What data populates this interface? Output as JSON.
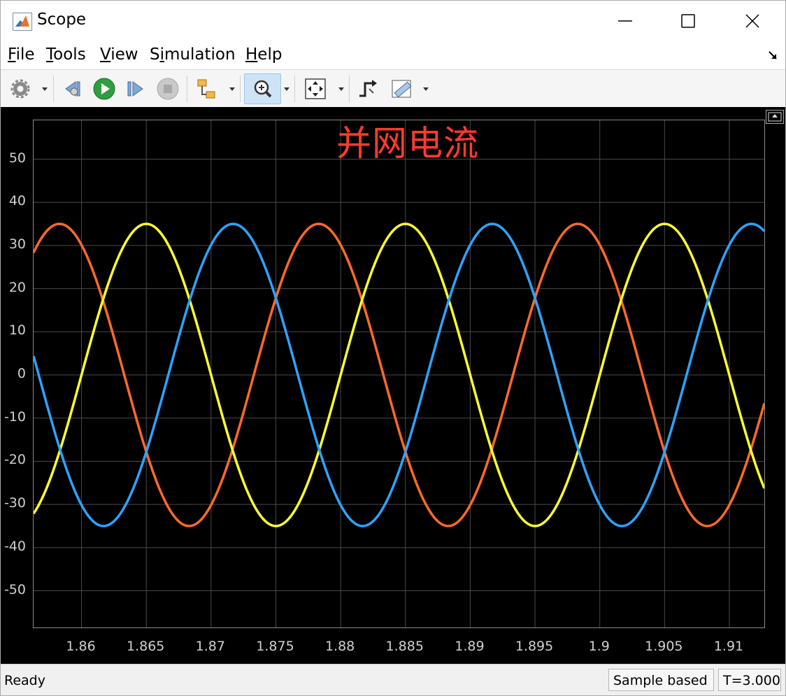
{
  "window": {
    "title": "Scope"
  },
  "menu": {
    "items": [
      {
        "label_acc": "F",
        "label_rest": "ile"
      },
      {
        "label_acc": "T",
        "label_rest": "ools"
      },
      {
        "label_acc": "V",
        "label_rest": "iew"
      },
      {
        "label_pre": "S",
        "label_acc": "i",
        "label_rest": "mulation"
      },
      {
        "label_acc": "H",
        "label_rest": "elp"
      }
    ]
  },
  "toolbar": {
    "buttons": [
      {
        "icon": "gear-icon"
      },
      {
        "icon": "step-back-icon"
      },
      {
        "icon": "run-icon"
      },
      {
        "icon": "step-forward-icon"
      },
      {
        "icon": "stop-icon"
      },
      {
        "icon": "highlight-block-icon"
      },
      {
        "icon": "zoom-in-icon"
      },
      {
        "icon": "autoscale-icon"
      },
      {
        "icon": "trigger-icon"
      },
      {
        "icon": "measurement-icon"
      }
    ]
  },
  "colors": {
    "series_blue": "#2ea3ff",
    "series_orange": "#ff6a2a",
    "series_yellow": "#ffff33",
    "title_red": "#ff3b30",
    "plot_bg": "#000000",
    "grid": "#4a4a4a"
  },
  "status": {
    "left": "Ready",
    "mode": "Sample based",
    "time": "T=3.000"
  },
  "chart_data": {
    "type": "line",
    "title": "并网电流",
    "xlabel": "",
    "ylabel": "",
    "xlim": [
      1.8563,
      1.9127
    ],
    "ylim": [
      -58.5,
      59
    ],
    "xticks": [
      "1.86",
      "1.865",
      "1.87",
      "1.875",
      "1.88",
      "1.885",
      "1.89",
      "1.895",
      "1.9",
      "1.905",
      "1.91"
    ],
    "xtick_values": [
      1.86,
      1.865,
      1.87,
      1.875,
      1.88,
      1.885,
      1.89,
      1.895,
      1.9,
      1.905,
      1.91
    ],
    "yticks": [
      "50",
      "40",
      "30",
      "20",
      "10",
      "0",
      "-10",
      "-20",
      "-30",
      "-40",
      "-50"
    ],
    "ytick_values": [
      50,
      40,
      30,
      20,
      10,
      0,
      -10,
      -20,
      -30,
      -40,
      -50
    ],
    "grid": true,
    "series": [
      {
        "color": "#ff6a2a",
        "amplitude": 35,
        "frequency": 50,
        "peak_time": 1.8583
      },
      {
        "color": "#ffff33",
        "amplitude": 35,
        "frequency": 50,
        "peak_time": 1.865
      },
      {
        "color": "#2ea3ff",
        "amplitude": 35,
        "frequency": 50,
        "peak_time": 1.8717
      }
    ]
  }
}
